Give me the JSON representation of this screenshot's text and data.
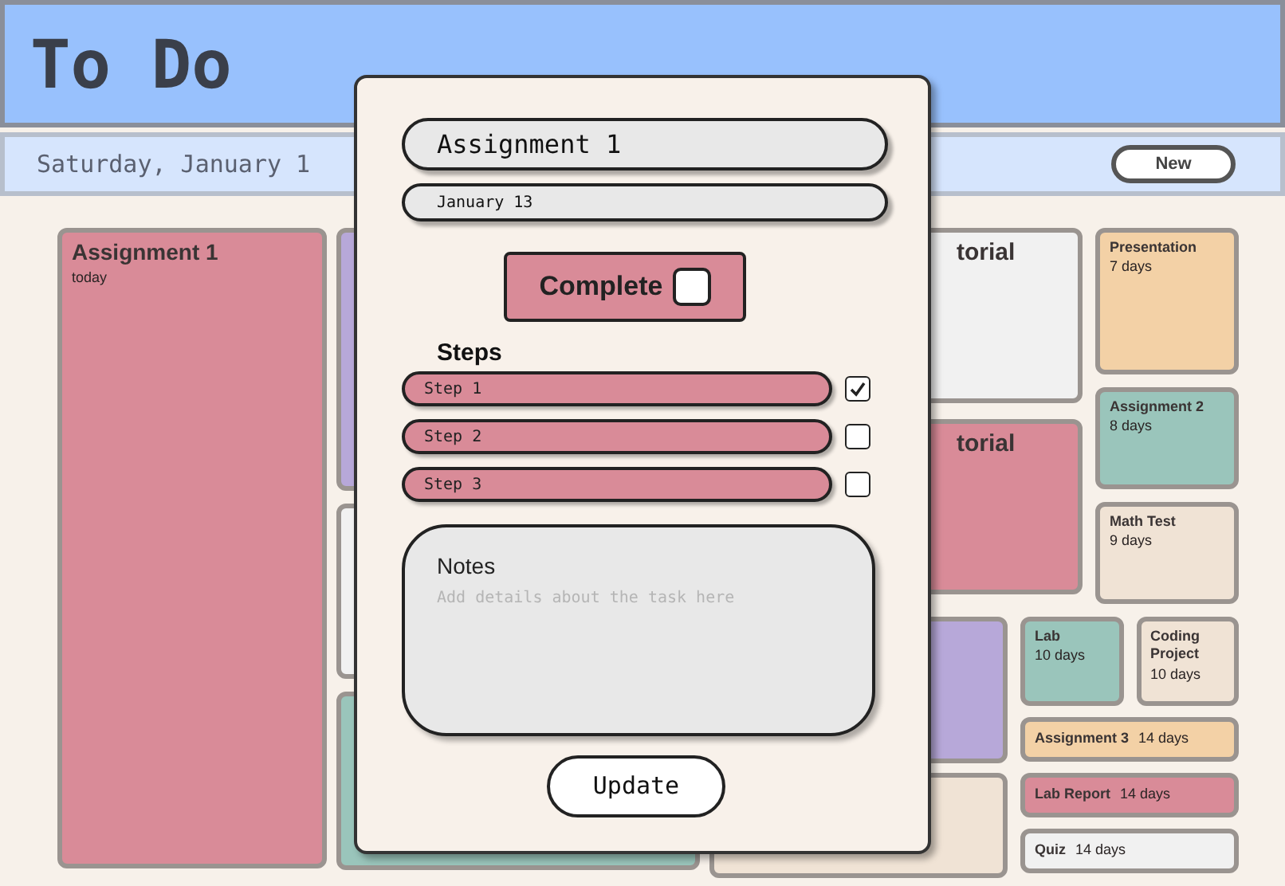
{
  "header": {
    "title": "To Do"
  },
  "subheader": {
    "date": "Saturday, January 1",
    "new_button": "New"
  },
  "board": {
    "left": [
      {
        "kind": "tile",
        "title": "Assignment 1",
        "due": "today",
        "color": "#d98b98"
      }
    ],
    "middle": [
      {
        "kind": "tile",
        "color": "#b7a8d9"
      },
      {
        "kind": "tile",
        "color": "#f1f1f1"
      },
      {
        "kind": "tile",
        "color": "#9ac5bb"
      }
    ],
    "right_top": [
      [
        {
          "kind": "tile",
          "title": "torial",
          "color": "#f1f1f1"
        },
        {
          "kind": "tile",
          "title": "torial",
          "color": "#d98b98"
        }
      ],
      [
        {
          "kind": "tile",
          "title": "Presentation",
          "due": "7 days",
          "color": "#f3d1a6"
        },
        {
          "kind": "tile",
          "title": "Assignment 2",
          "due": "8 days",
          "color": "#9ac5bb"
        },
        {
          "kind": "tile",
          "title": "Math Test",
          "due": "9 days",
          "color": "#f0e3d5"
        }
      ]
    ],
    "right_bottom": [
      [
        {
          "kind": "tile",
          "color": "#b7a8d9"
        },
        {
          "kind": "tile",
          "color": "#f0e3d5"
        }
      ],
      [
        {
          "kind": "pair",
          "tiles": [
            {
              "kind": "tile",
              "title": "Lab",
              "due": "10 days",
              "color": "#9ac5bb"
            },
            {
              "kind": "tile",
              "title": "Coding Project",
              "due": "10 days",
              "color": "#f0e3d5"
            }
          ]
        },
        {
          "kind": "strip",
          "title": "Assignment 3",
          "due": "14 days",
          "color": "#f3d1a6"
        },
        {
          "kind": "strip",
          "title": "Lab Report",
          "due": "14 days",
          "color": "#d98b98"
        },
        {
          "kind": "strip",
          "title": "Quiz",
          "due": "14 days",
          "color": "#f1f1f1"
        }
      ]
    ]
  },
  "modal": {
    "title": "Assignment 1",
    "date": "January 13",
    "complete": {
      "label": "Complete",
      "checked": false
    },
    "steps_heading": "Steps",
    "steps": [
      {
        "text": "Step 1",
        "checked": true
      },
      {
        "text": "Step 2",
        "checked": false
      },
      {
        "text": "Step 3",
        "checked": false
      }
    ],
    "notes": {
      "label": "Notes",
      "placeholder": "Add details about the task here"
    },
    "update_button": "Update"
  }
}
